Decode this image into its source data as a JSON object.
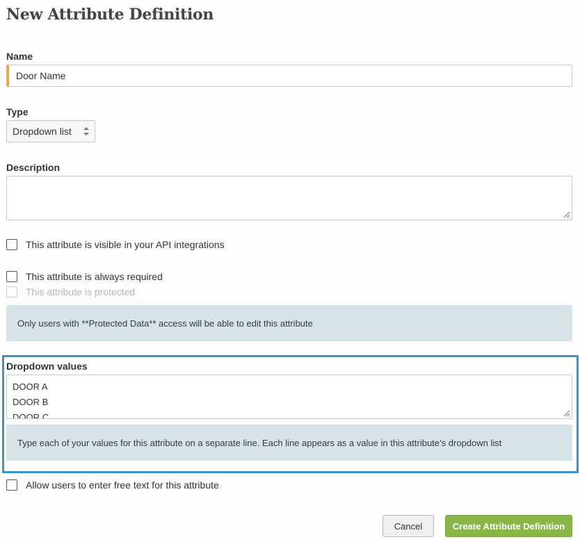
{
  "page_title": "New Attribute Definition",
  "name_field": {
    "label": "Name",
    "value": "Door Name"
  },
  "type_field": {
    "label": "Type",
    "selected": "Dropdown list",
    "icon": "up-down-arrows-icon"
  },
  "description_field": {
    "label": "Description",
    "value": ""
  },
  "checkboxes": {
    "api_visible": {
      "label": "This attribute is visible in your API integrations",
      "checked": false
    },
    "always_required": {
      "label": "This attribute is always required",
      "checked": false
    },
    "protected": {
      "label": "This attribute is protected",
      "checked": false,
      "disabled": true
    }
  },
  "protected_info": "Only users with **Protected Data** access will be able to edit this attribute",
  "dropdown_values": {
    "label": "Dropdown values",
    "lines": [
      "DOOR A",
      "DOOR B",
      "DOOR C"
    ],
    "help": "Type each of your values for this attribute on a separate line. Each line appears as a value in this attribute’s dropdown list"
  },
  "free_text": {
    "label": "Allow users to enter free text for this attribute",
    "checked": false
  },
  "buttons": {
    "cancel": "Cancel",
    "create": "Create Attribute Definition"
  },
  "colors": {
    "accent_required": "#e2a950",
    "highlight_border": "#3b94c6",
    "info_bg": "#d6e3e9",
    "primary_button": "#8ab54a"
  }
}
